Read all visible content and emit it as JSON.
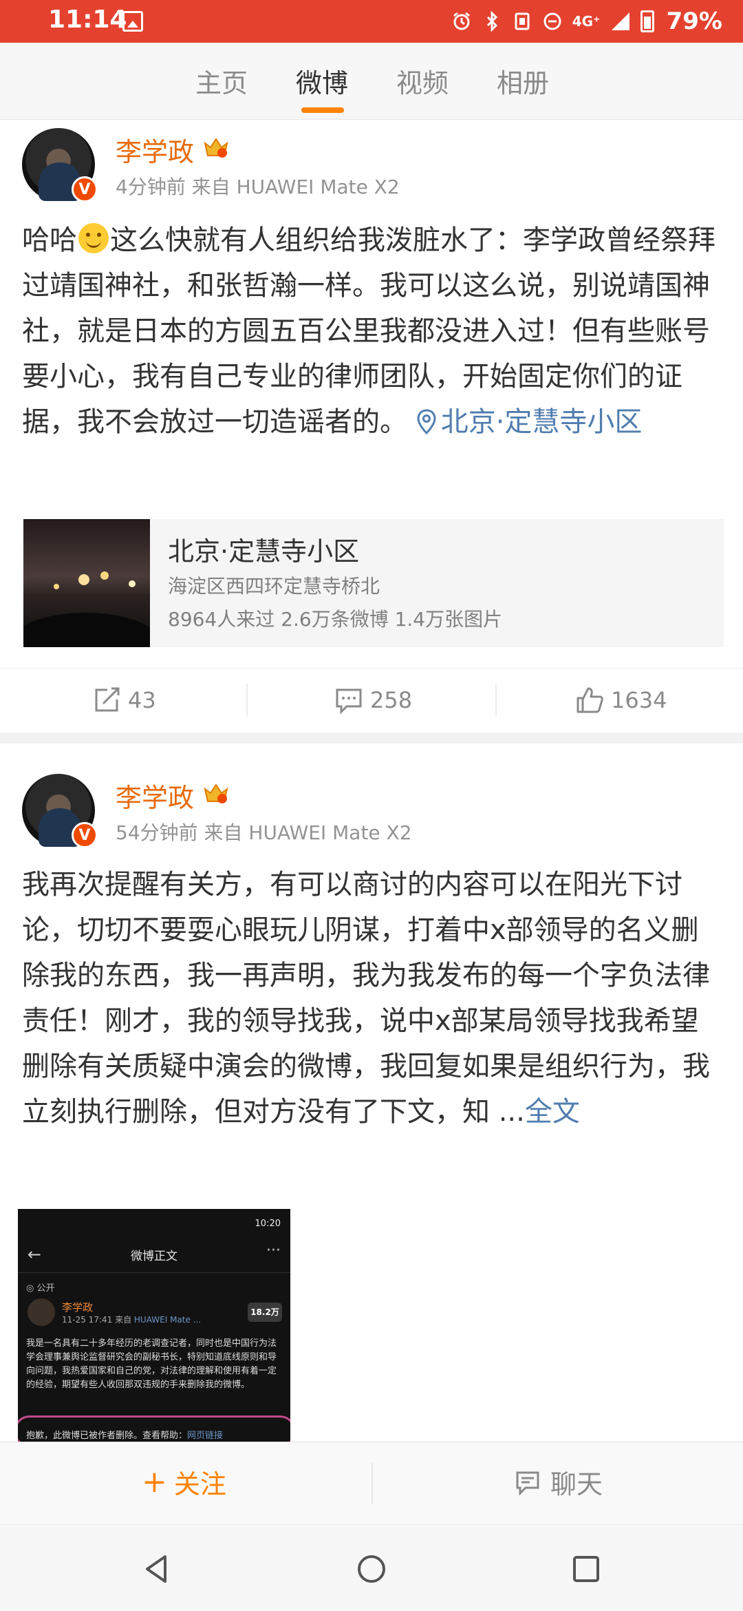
{
  "status_bar": {
    "time": "11:14",
    "network": "4G⁺",
    "battery": "79%"
  },
  "tabs": [
    "主页",
    "微博",
    "视频",
    "相册"
  ],
  "active_tab": 1,
  "accent_color": "#ff8200",
  "posts": [
    {
      "author": "李学政",
      "meta": "4分钟前  来自 HUAWEI Mate X2",
      "text_before_emoji": "哈哈",
      "text": "这么快就有人组织给我泼脏水了：李学政曾经祭拜过靖国神社，和张哲瀚一样。我可以这么说，别说靖国神社，就是日本的方圆五百公里我都没进入过！但有些账号要小心，我有自己专业的律师团队，开始固定你们的证据，我不会放过一切造谣者的。",
      "location_link": "北京·定慧寺小区",
      "location_card": {
        "title": "北京·定慧寺小区",
        "address": "海淀区西四环定慧寺桥北",
        "stats": "8964人来过  2.6万条微博  1.4万张图片"
      },
      "reposts": "43",
      "comments": "258",
      "likes": "1634"
    },
    {
      "author": "李学政",
      "meta": "54分钟前  来自 HUAWEI Mate X2",
      "text": "我再次提醒有关方，有可以商讨的内容可以在阳光下讨论，切切不要耍心眼玩儿阴谋，打着中x部领导的名义删除我的东西，我一再声明，我为我发布的每一个字负法律责任！刚才，我的领导找我，说中x部某局领导找我希望删除有关质疑中演会的微博，我回复如果是组织行为，我立刻执行删除，但对方没有了下文，知 ...",
      "more_link": "全文",
      "embedded_screenshot": {
        "time": "10:20",
        "title": "微博正文",
        "visibility": "公开",
        "author": "李学政",
        "meta_prefix": "11-25 17:41  来自 ",
        "meta_device": "HUAWEI Mate ...",
        "count": "18.2万",
        "body": "我是一名具有二十多年经历的老调查记者，同时也是中国行为法学会理事兼舆论监督研究会的副秘书长，特别知道底线原则和导向问题，我热爱国家和自己的党，对法律的理解和使用有着一定的经验，期望有些人收回那双违规的手来删除我的微博。",
        "notice": "抱歉，此微博已被作者删除。查看帮助：",
        "notice_link": "网页链接"
      }
    }
  ],
  "bottom_bar": {
    "follow_label": "关注",
    "chat_label": "聊天"
  }
}
